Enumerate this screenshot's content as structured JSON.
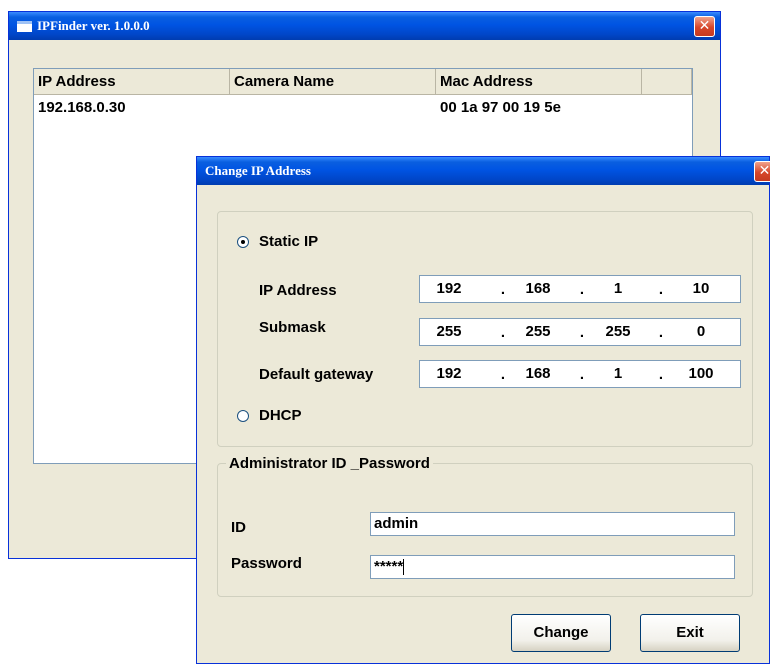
{
  "main_window": {
    "title": "IPFinder ver. 1.0.0.0",
    "close_glyph": "✕",
    "list": {
      "columns": [
        "IP Address",
        "Camera Name",
        "Mac Address",
        ""
      ],
      "rows": [
        {
          "ip": "192.168.0.30",
          "camera_name": "",
          "mac": "00 1a 97 00 19 5e"
        }
      ]
    }
  },
  "dialog": {
    "title": "Change IP Address",
    "close_glyph": "✕",
    "ip_mode": {
      "static_label": "Static IP",
      "static_selected": true,
      "dhcp_label": "DHCP",
      "dhcp_selected": false
    },
    "fields": {
      "ip_address": {
        "label": "IP Address",
        "octets": [
          "192",
          "168",
          "1",
          "10"
        ]
      },
      "submask": {
        "label": "Submask",
        "octets": [
          "255",
          "255",
          "255",
          "0"
        ]
      },
      "gateway": {
        "label": "Default gateway",
        "octets": [
          "192",
          "168",
          "1",
          "100"
        ]
      }
    },
    "credentials": {
      "legend": "Administrator ID _Password",
      "id_label": "ID",
      "id_value": "admin",
      "password_label": "Password",
      "password_value": "*****"
    },
    "buttons": {
      "change": "Change",
      "exit": "Exit"
    }
  }
}
